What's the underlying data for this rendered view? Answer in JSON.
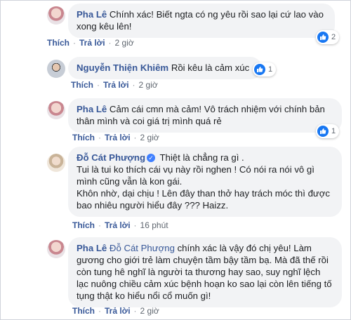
{
  "comments": [
    {
      "author": "Pha Lê",
      "text": "Chính xác! Biết ngta có ng yêu rồi sao lại cứ lao vào xong kêu lên!",
      "like_label": "Thích",
      "reply_label": "Trả lời",
      "time": "2 giờ",
      "reaction_icon": "like-icon",
      "reaction_count": "2"
    },
    {
      "author": "Nguyễn Thiện Khiêm",
      "text": "Rồi kêu là cảm xúc",
      "like_label": "Thích",
      "reply_label": "Trả lời",
      "time": "2 giờ",
      "reaction_icon": "like-icon",
      "reaction_count": "1"
    },
    {
      "author": "Pha Lê",
      "text": "Cảm cái cmn mà cảm! Vô trách nhiệm với chính bản thân mình và coi giá trị mình quá rẻ",
      "like_label": "Thích",
      "reply_label": "Trả lời",
      "time": "2 giờ",
      "reaction_icon": "like-icon",
      "reaction_count": "1"
    },
    {
      "author": "Đỗ Cát Phượng",
      "verified": true,
      "text_lines": [
        "Thiệt là chẳng ra gì .",
        "Tui là tui ko thích cái vụ này rồi nghen ! Có nói ra nói vô gì mình cũng vẫn là kon gái.",
        "Khôn nhờ, dại chịu ! Lên đây than thở hay trách móc thì được bao nhiêu người hiểu đây ??? Haizz."
      ],
      "like_label": "Thích",
      "reply_label": "Trả lời",
      "time": "16 phút"
    },
    {
      "author": "Pha Lê",
      "tag": "Đỗ Cát Phượng",
      "text": "chính xác là vậy đó chị yêu! Làm gương cho giới trẻ làm chuyện tầm bậy tầm bạ. Mà đã thế rồi còn tung hê nghĩ là người ta thương hay sao, suy nghĩ lệch lạc nuông chiều cảm xúc bệnh hoạn ko sao lại còn lên tiếng tố tụng thật ko hiểu nổi cổ muốn gì!",
      "like_label": "Thích",
      "reply_label": "Trả lời",
      "time": "2 giờ"
    }
  ],
  "colors": {
    "name": "#385898",
    "bubble": "#f2f3f5",
    "like_blue": "#1877f2"
  }
}
